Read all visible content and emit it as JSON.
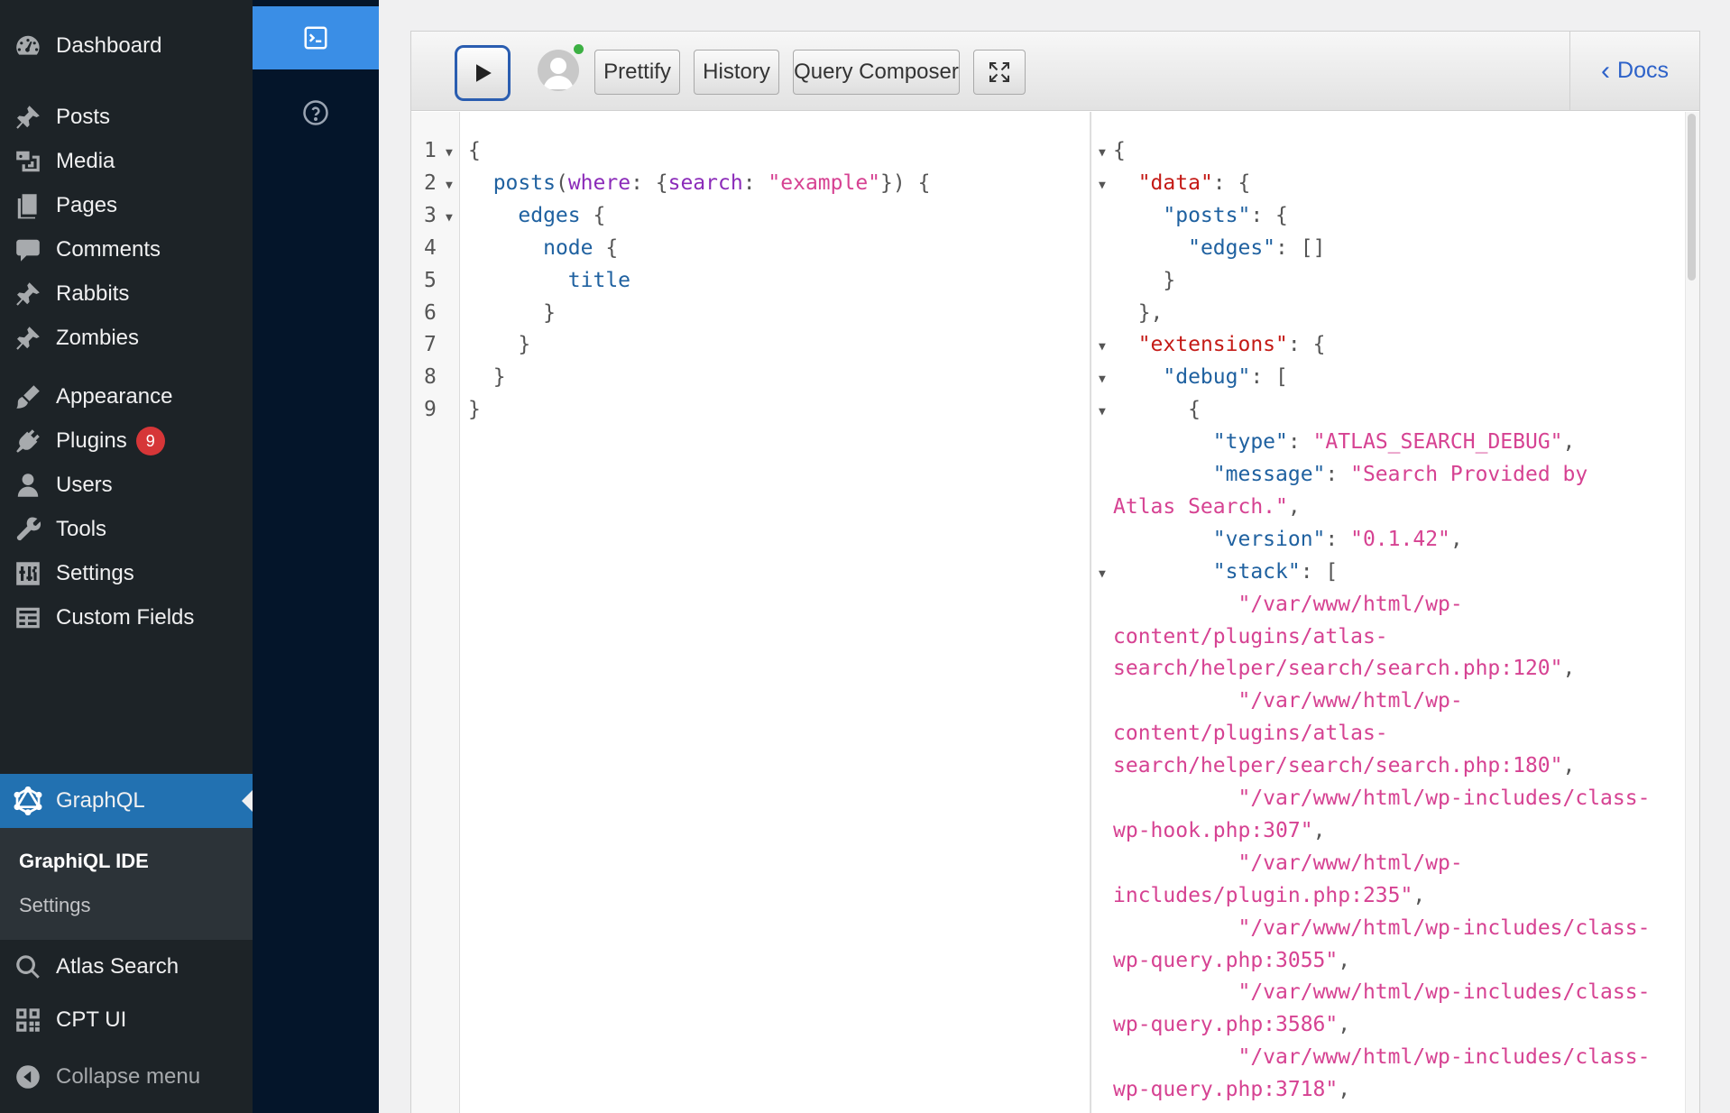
{
  "admin_menu": {
    "items": [
      {
        "label": "Dashboard",
        "icon": "dashboard-icon"
      },
      {
        "label": "Posts",
        "icon": "pin-icon"
      },
      {
        "label": "Media",
        "icon": "media-icon"
      },
      {
        "label": "Pages",
        "icon": "pages-icon"
      },
      {
        "label": "Comments",
        "icon": "comment-icon"
      },
      {
        "label": "Rabbits",
        "icon": "pin-icon"
      },
      {
        "label": "Zombies",
        "icon": "pin-icon"
      },
      {
        "label": "Appearance",
        "icon": "brush-icon"
      },
      {
        "label": "Plugins",
        "icon": "plug-icon",
        "badge": "9"
      },
      {
        "label": "Users",
        "icon": "user-icon"
      },
      {
        "label": "Tools",
        "icon": "wrench-icon"
      },
      {
        "label": "Settings",
        "icon": "settings-icon"
      },
      {
        "label": "Custom Fields",
        "icon": "table-icon"
      },
      {
        "label": "GraphQL",
        "icon": "graphql-icon",
        "current": true
      },
      {
        "label": "Atlas Search",
        "icon": "search-icon"
      },
      {
        "label": "CPT UI",
        "icon": "grid-icon"
      }
    ],
    "submenu": [
      {
        "label": "GraphiQL IDE",
        "current": true
      },
      {
        "label": "Settings"
      }
    ],
    "collapse_label": "Collapse menu"
  },
  "plugin_bar": {
    "buttons": [
      {
        "icon": "terminal-icon",
        "active": true
      },
      {
        "icon": "help-icon"
      }
    ]
  },
  "toolbar": {
    "execute_icon": "play-icon",
    "prettify_label": "Prettify",
    "history_label": "History",
    "composer_label": "Query Composer",
    "fullscreen_icon": "fullscreen-icon",
    "docs_label": "Docs"
  },
  "colors": {
    "menu_bg": "#1d2327",
    "menu_current": "#2271b1",
    "plugin_bar_bg": "#04152a",
    "plugin_active": "#3a8ee6",
    "badge": "#d63638",
    "execute_border": "#2a5db0"
  },
  "query_editor": {
    "line_numbers": [
      "1",
      "2",
      "3",
      "4",
      "5",
      "6",
      "7",
      "8",
      "9"
    ],
    "lines": [
      [
        {
          "t": "{",
          "c": "p"
        }
      ],
      [
        {
          "t": "  ",
          "c": "p"
        },
        {
          "t": "posts",
          "c": "field"
        },
        {
          "t": "(",
          "c": "p"
        },
        {
          "t": "where",
          "c": "arg"
        },
        {
          "t": ": {",
          "c": "p"
        },
        {
          "t": "search",
          "c": "arg"
        },
        {
          "t": ": ",
          "c": "p"
        },
        {
          "t": "\"example\"",
          "c": "str"
        },
        {
          "t": "}) {",
          "c": "p"
        }
      ],
      [
        {
          "t": "    ",
          "c": "p"
        },
        {
          "t": "edges",
          "c": "field"
        },
        {
          "t": " {",
          "c": "p"
        }
      ],
      [
        {
          "t": "      ",
          "c": "p"
        },
        {
          "t": "node",
          "c": "field"
        },
        {
          "t": " {",
          "c": "p"
        }
      ],
      [
        {
          "t": "        ",
          "c": "p"
        },
        {
          "t": "title",
          "c": "field"
        }
      ],
      [
        {
          "t": "      }",
          "c": "p"
        }
      ],
      [
        {
          "t": "    }",
          "c": "p"
        }
      ],
      [
        {
          "t": "  }",
          "c": "p"
        }
      ],
      [
        {
          "t": "}",
          "c": "p"
        }
      ]
    ]
  },
  "result_viewer": {
    "lines": [
      [
        {
          "t": "{",
          "c": "p"
        }
      ],
      [
        {
          "t": "  ",
          "c": "p"
        },
        {
          "t": "\"data\"",
          "c": "key"
        },
        {
          "t": ": {",
          "c": "p"
        }
      ],
      [
        {
          "t": "    ",
          "c": "p"
        },
        {
          "t": "\"posts\"",
          "c": "prop"
        },
        {
          "t": ": {",
          "c": "p"
        }
      ],
      [
        {
          "t": "      ",
          "c": "p"
        },
        {
          "t": "\"edges\"",
          "c": "prop"
        },
        {
          "t": ": []",
          "c": "p"
        }
      ],
      [
        {
          "t": "    }",
          "c": "p"
        }
      ],
      [
        {
          "t": "  },",
          "c": "p"
        }
      ],
      [
        {
          "t": "  ",
          "c": "p"
        },
        {
          "t": "\"extensions\"",
          "c": "key"
        },
        {
          "t": ": {",
          "c": "p"
        }
      ],
      [
        {
          "t": "    ",
          "c": "p"
        },
        {
          "t": "\"debug\"",
          "c": "prop"
        },
        {
          "t": ": [",
          "c": "p"
        }
      ],
      [
        {
          "t": "      {",
          "c": "p"
        }
      ],
      [
        {
          "t": "        ",
          "c": "p"
        },
        {
          "t": "\"type\"",
          "c": "prop"
        },
        {
          "t": ": ",
          "c": "p"
        },
        {
          "t": "\"ATLAS_SEARCH_DEBUG\"",
          "c": "str"
        },
        {
          "t": ",",
          "c": "p"
        }
      ],
      [
        {
          "t": "        ",
          "c": "p"
        },
        {
          "t": "\"message\"",
          "c": "prop"
        },
        {
          "t": ": ",
          "c": "p"
        },
        {
          "t": "\"Search Provided by",
          "c": "str"
        }
      ],
      [
        {
          "t": "Atlas Search.\"",
          "c": "str"
        },
        {
          "t": ",",
          "c": "p"
        }
      ],
      [
        {
          "t": "        ",
          "c": "p"
        },
        {
          "t": "\"version\"",
          "c": "prop"
        },
        {
          "t": ": ",
          "c": "p"
        },
        {
          "t": "\"0.1.42\"",
          "c": "str"
        },
        {
          "t": ",",
          "c": "p"
        }
      ],
      [
        {
          "t": "        ",
          "c": "p"
        },
        {
          "t": "\"stack\"",
          "c": "prop"
        },
        {
          "t": ": [",
          "c": "p"
        }
      ],
      [
        {
          "t": "          ",
          "c": "p"
        },
        {
          "t": "\"/var/www/html/wp-",
          "c": "str"
        }
      ],
      [
        {
          "t": "content/plugins/atlas-",
          "c": "str"
        }
      ],
      [
        {
          "t": "search/helper/search/search.php:120\"",
          "c": "str"
        },
        {
          "t": ",",
          "c": "p"
        }
      ],
      [
        {
          "t": "          ",
          "c": "p"
        },
        {
          "t": "\"/var/www/html/wp-",
          "c": "str"
        }
      ],
      [
        {
          "t": "content/plugins/atlas-",
          "c": "str"
        }
      ],
      [
        {
          "t": "search/helper/search/search.php:180\"",
          "c": "str"
        },
        {
          "t": ",",
          "c": "p"
        }
      ],
      [
        {
          "t": "          ",
          "c": "p"
        },
        {
          "t": "\"/var/www/html/wp-includes/class-",
          "c": "str"
        }
      ],
      [
        {
          "t": "wp-hook.php:307\"",
          "c": "str"
        },
        {
          "t": ",",
          "c": "p"
        }
      ],
      [
        {
          "t": "          ",
          "c": "p"
        },
        {
          "t": "\"/var/www/html/wp-",
          "c": "str"
        }
      ],
      [
        {
          "t": "includes/plugin.php:235\"",
          "c": "str"
        },
        {
          "t": ",",
          "c": "p"
        }
      ],
      [
        {
          "t": "          ",
          "c": "p"
        },
        {
          "t": "\"/var/www/html/wp-includes/class-",
          "c": "str"
        }
      ],
      [
        {
          "t": "wp-query.php:3055\"",
          "c": "str"
        },
        {
          "t": ",",
          "c": "p"
        }
      ],
      [
        {
          "t": "          ",
          "c": "p"
        },
        {
          "t": "\"/var/www/html/wp-includes/class-",
          "c": "str"
        }
      ],
      [
        {
          "t": "wp-query.php:3586\"",
          "c": "str"
        },
        {
          "t": ",",
          "c": "p"
        }
      ],
      [
        {
          "t": "          ",
          "c": "p"
        },
        {
          "t": "\"/var/www/html/wp-includes/class-",
          "c": "str"
        }
      ],
      [
        {
          "t": "wp-query.php:3718\"",
          "c": "str"
        },
        {
          "t": ",",
          "c": "p"
        }
      ]
    ],
    "fold_lines": [
      0,
      1,
      6,
      7,
      8,
      13
    ]
  }
}
